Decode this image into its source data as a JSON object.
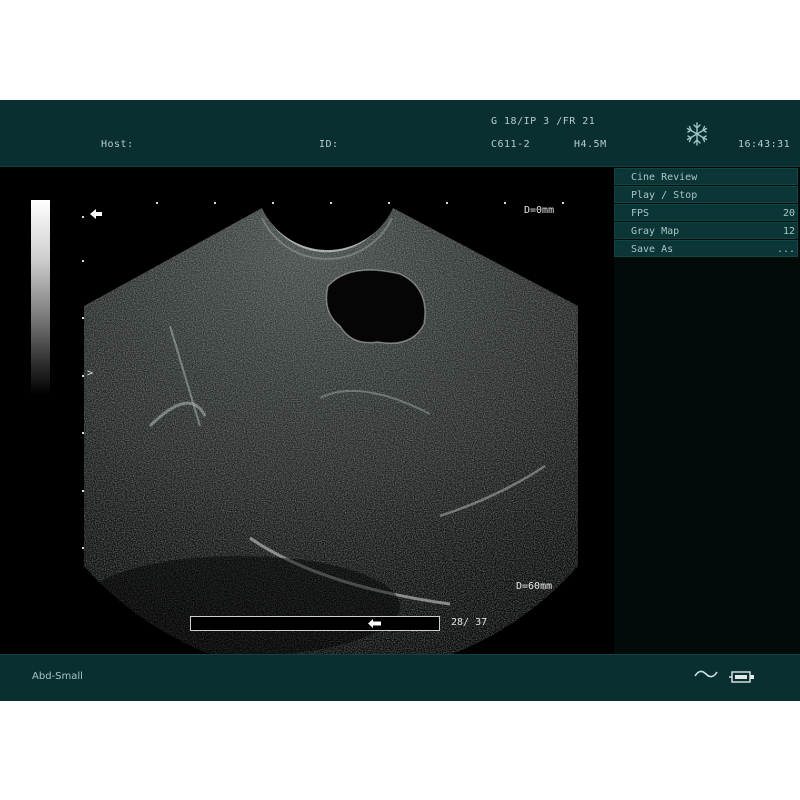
{
  "header": {
    "params": "G 18/IP 3 /FR 21",
    "host_label": "Host:",
    "id_label": "ID:",
    "probe": "C611-2",
    "frequency": "H4.5M",
    "time": "16:43:31"
  },
  "menu": {
    "title": "Cine Review",
    "items": [
      {
        "label": "Play / Stop",
        "value": ""
      },
      {
        "label": "FPS",
        "value": "20"
      },
      {
        "label": "Gray Map",
        "value": "12"
      },
      {
        "label": "Save As",
        "value": "..."
      }
    ]
  },
  "image": {
    "depth_top": "D=0mm",
    "depth_bottom": "D=60mm",
    "focus_marker": ">"
  },
  "cine": {
    "frame": "28/ 37",
    "position_fraction": 0.757
  },
  "footer": {
    "preset": "Abd-Small"
  },
  "icons": {
    "freeze": "snowflake-icon",
    "orientation": "left-arrow-icon",
    "wave": "wave-icon",
    "printer": "printer-icon"
  },
  "colors": {
    "panel_bg": "#0a2f30",
    "menu_item_bg": "#0b3536",
    "text": "#b5cccc"
  }
}
